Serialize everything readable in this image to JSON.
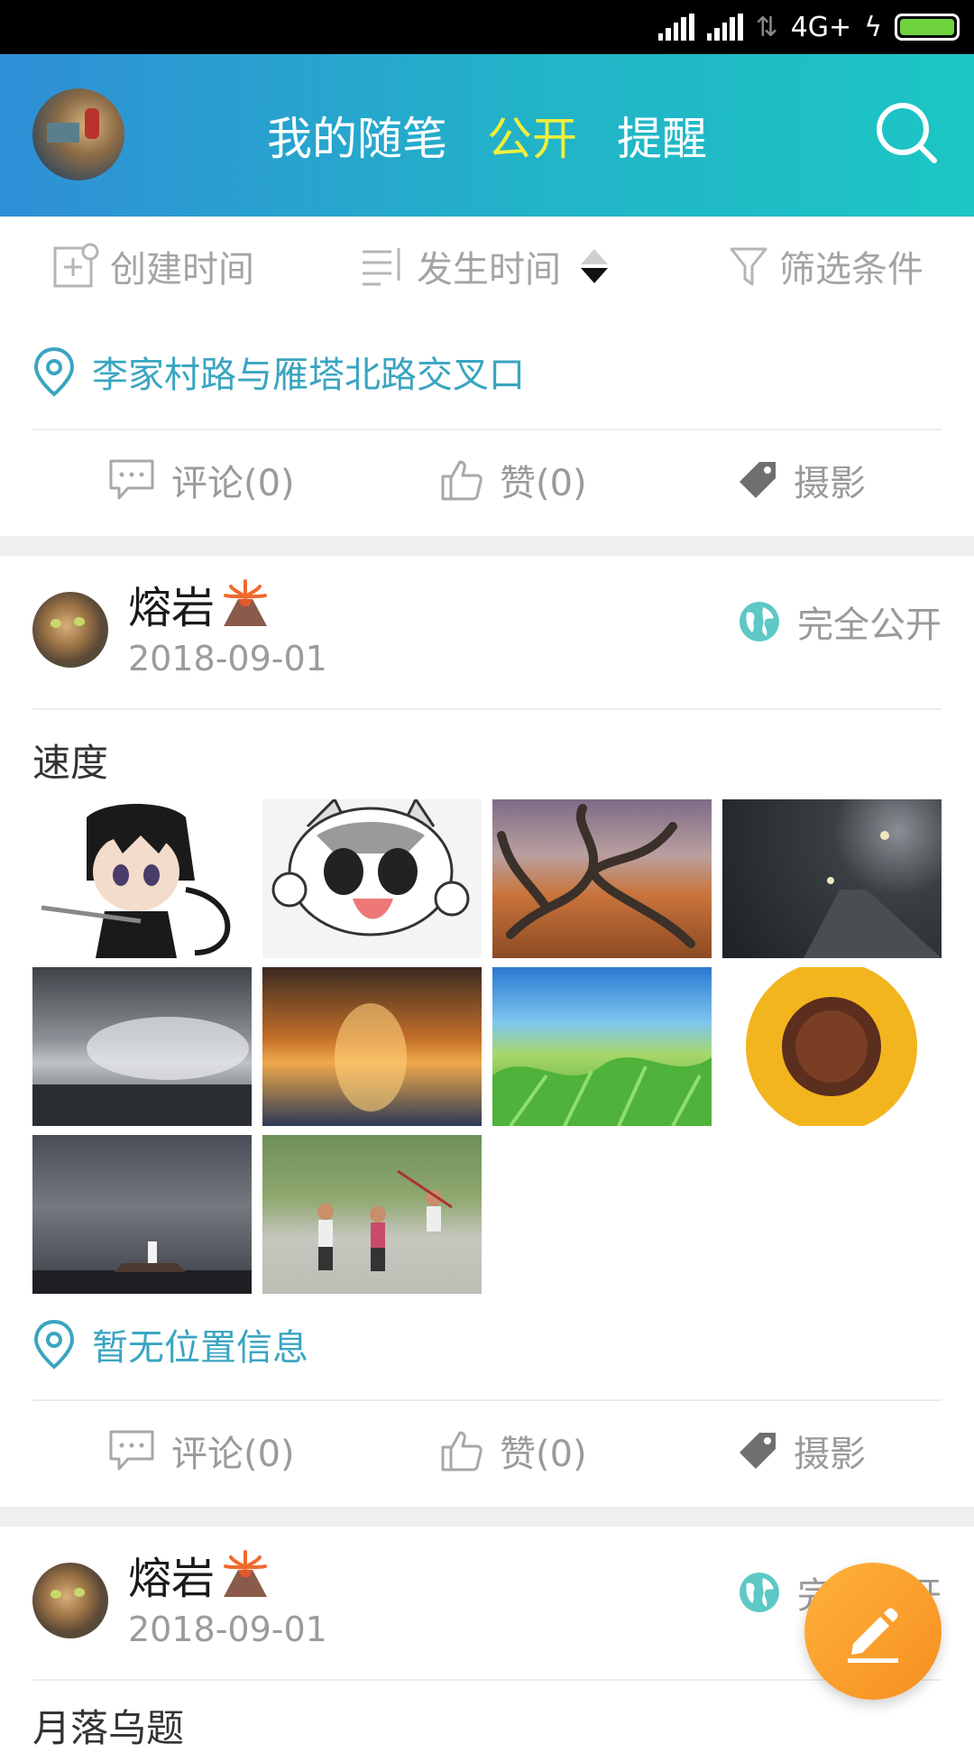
{
  "status_bar": {
    "network": "4G+"
  },
  "header": {
    "tabs": [
      {
        "label": "我的随笔",
        "active": false
      },
      {
        "label": "公开",
        "active": true
      },
      {
        "label": "提醒",
        "active": false
      }
    ],
    "accent_colors": {
      "active_tab": "#f1ef3a",
      "gradient_start": "#2f8fd6",
      "gradient_end": "#1cc6c4"
    }
  },
  "sort_bar": {
    "create_time": "创建时间",
    "occur_time": "发生时间",
    "filter": "筛选条件"
  },
  "posts": [
    {
      "location": "李家村路与雁塔北路交叉口",
      "comment": "评论(0)",
      "like": "赞(0)",
      "tag": "摄影"
    },
    {
      "username": "熔岩",
      "date": "2018-09-01",
      "privacy": "完全公开",
      "title": "速度",
      "image_count": 10,
      "location": "暂无位置信息",
      "comment": "评论(0)",
      "like": "赞(0)",
      "tag": "摄影"
    },
    {
      "username": "熔岩",
      "date": "2018-09-01",
      "privacy": "完全公开",
      "title": "月落乌题"
    }
  ],
  "colors": {
    "link": "#3aa5c1",
    "fab": "#f7991f",
    "globe": "#5dc8c5"
  }
}
